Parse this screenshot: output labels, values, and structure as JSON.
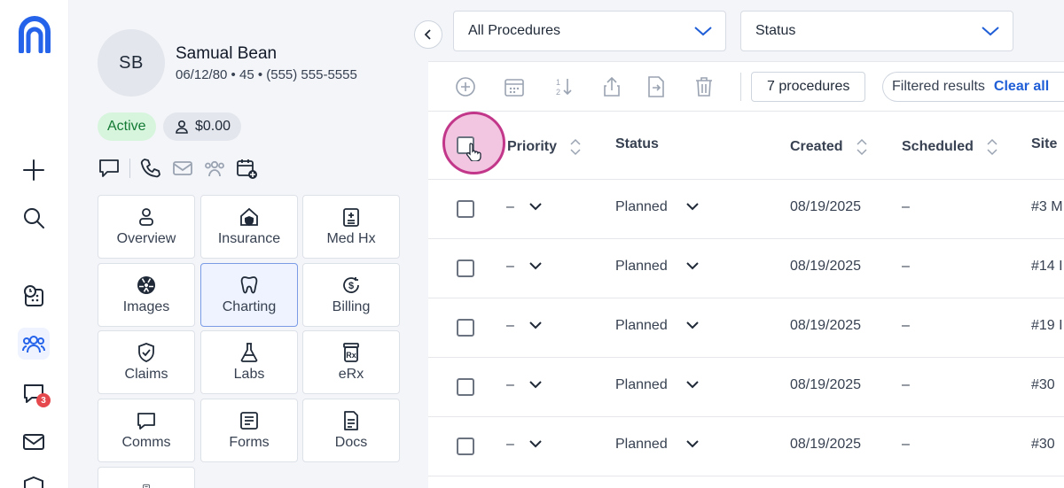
{
  "rail": {
    "messages_badge": "3"
  },
  "patient": {
    "initials": "SB",
    "name": "Samual Bean",
    "meta": "06/12/80 • 45 • (555) 555-5555",
    "status": "Active",
    "balance": "$0.00"
  },
  "tiles": [
    {
      "label": "Overview",
      "icon": "person-icon"
    },
    {
      "label": "Insurance",
      "icon": "insurance-icon"
    },
    {
      "label": "Med Hx",
      "icon": "clipboard-icon"
    },
    {
      "label": "Images",
      "icon": "radiation-icon"
    },
    {
      "label": "Charting",
      "icon": "tooth-icon",
      "selected": true
    },
    {
      "label": "Billing",
      "icon": "billing-icon"
    },
    {
      "label": "Claims",
      "icon": "shield-check-icon"
    },
    {
      "label": "Labs",
      "icon": "flask-icon"
    },
    {
      "label": "eRx",
      "icon": "prescription-icon"
    },
    {
      "label": "Comms",
      "icon": "chat-icon"
    },
    {
      "label": "Forms",
      "icon": "form-icon"
    },
    {
      "label": "Docs",
      "icon": "document-icon"
    }
  ],
  "filters": {
    "procedures": "All Procedures",
    "status": "Status"
  },
  "toolbar": {
    "count": "7 procedures",
    "filtered": "Filtered results",
    "clear": "Clear all"
  },
  "columns": {
    "priority": "Priority",
    "status": "Status",
    "created": "Created",
    "scheduled": "Scheduled",
    "site": "Site"
  },
  "rows": [
    {
      "priority": "–",
      "status": "Planned",
      "created": "08/19/2025",
      "scheduled": "–",
      "site": "#3 M"
    },
    {
      "priority": "–",
      "status": "Planned",
      "created": "08/19/2025",
      "scheduled": "–",
      "site": "#14 I"
    },
    {
      "priority": "–",
      "status": "Planned",
      "created": "08/19/2025",
      "scheduled": "–",
      "site": "#19 I"
    },
    {
      "priority": "–",
      "status": "Planned",
      "created": "08/19/2025",
      "scheduled": "–",
      "site": "#30"
    },
    {
      "priority": "–",
      "status": "Planned",
      "created": "08/19/2025",
      "scheduled": "–",
      "site": "#30"
    }
  ],
  "colors": {
    "accent": "#1f5ed6",
    "active_bg": "#d7f5dc",
    "active_text": "#137a35",
    "click_ring": "#c2378a"
  }
}
